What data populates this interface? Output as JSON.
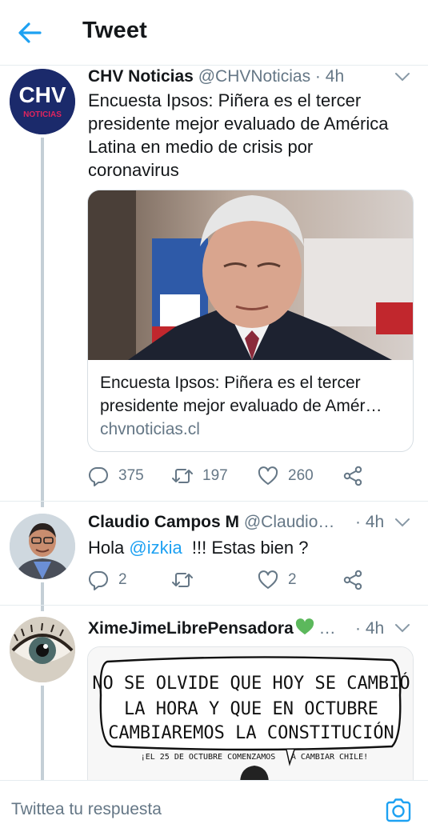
{
  "header": {
    "title": "Tweet"
  },
  "tweets": [
    {
      "name": "CHV Noticias",
      "handle": "@CHVNoticias",
      "sep": "·",
      "time": "4h",
      "text_lines": [
        "Encuesta Ipsos: Piñera es el tercer",
        "presidente mejor evaluado de América",
        "Latina en medio de crisis por",
        "coronavirus"
      ],
      "avatar_logo": {
        "top": "CHV",
        "bottom": "NOTICIAS"
      },
      "card": {
        "title_line1": "Encuesta Ipsos: Piñera es el tercer",
        "title_line2": "presidente mejor evaluado de Amér…",
        "domain": "chvnoticias.cl"
      },
      "replies": "375",
      "retweets": "197",
      "likes": "260"
    },
    {
      "name": "Claudio Campos M",
      "handle": "@Claudio…",
      "sep": "·",
      "time": "4h",
      "text_pre": "Hola ",
      "mention": "@izkia",
      "text_post": "  !!! Estas bien ?",
      "replies": "2",
      "retweets": "",
      "likes": "2"
    },
    {
      "name": "XimeJimeLibrePensadora",
      "handle": "…",
      "sep": "·",
      "time": "4h",
      "comic": {
        "line1": "NO SE OLVIDE QUE HOY SE CAMBIÓ",
        "line2": "LA HORA Y QUE EN OCTUBRE",
        "line3": "CAMBIAREMOS LA CONSTITUCIÓN",
        "sub1": "¡EL 25 DE OCTUBRE COMENZAMOS",
        "sub2": "A CAMBIAR CHILE!"
      }
    }
  ],
  "reply_bar": {
    "placeholder": "Twittea tu respuesta"
  },
  "icons": {
    "back": "arrow-left-icon",
    "chevron": "chevron-down-icon",
    "reply": "reply-icon",
    "retweet": "retweet-icon",
    "like": "heart-icon",
    "share": "share-icon",
    "camera": "camera-icon"
  },
  "colors": {
    "accent": "#1da1f2",
    "text": "#14171a",
    "secondary": "#657786",
    "border": "#e6ecf0",
    "green_heart": "#5cb85c"
  }
}
